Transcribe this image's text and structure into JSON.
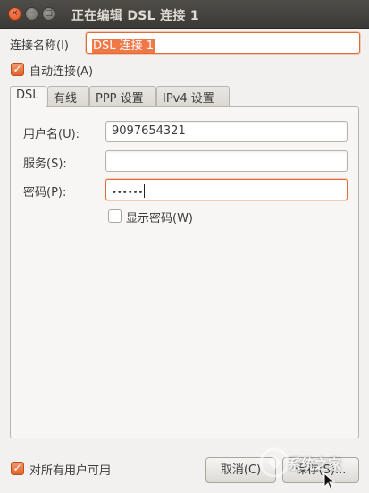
{
  "window": {
    "title": "正在编辑 DSL 连接 1",
    "close_glyph": "×",
    "min_glyph": "−",
    "max_glyph": "□"
  },
  "connection_name": {
    "label": "连接名称(I)",
    "value": "DSL 连接 1"
  },
  "auto_connect": {
    "label": "自动连接(A)",
    "checked": true
  },
  "tabs": [
    {
      "label": "DSL",
      "active": true
    },
    {
      "label": "有线",
      "active": false
    },
    {
      "label": "PPP 设置",
      "active": false
    },
    {
      "label": "IPv4 设置",
      "active": false
    }
  ],
  "dsl": {
    "username_label": "用户名(U):",
    "username_value": "9097654321",
    "service_label": "服务(S):",
    "service_value": "",
    "password_label": "密码(P):",
    "password_value": "••••••",
    "show_password_label": "显示密码(W)",
    "show_password_checked": false
  },
  "all_users": {
    "label": "对所有用户可用",
    "checked": true
  },
  "buttons": {
    "cancel_label": "取消(C)",
    "save_label": "保存(S)..."
  },
  "watermark": {
    "text": "系统之家"
  },
  "colors": {
    "accent": "#f07746",
    "titlebar": "#3b3a36",
    "background": "#f2f1ef"
  }
}
